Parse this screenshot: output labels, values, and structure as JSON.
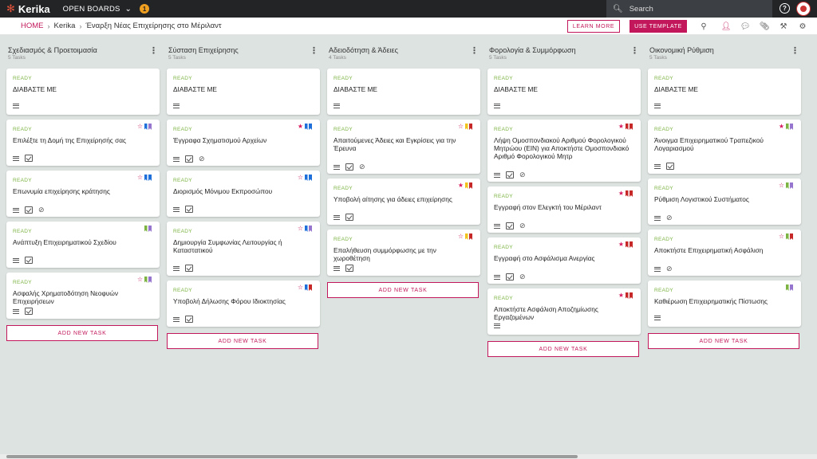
{
  "app": {
    "name": "Kerika",
    "open_boards_label": "OPEN BOARDS",
    "notification_count": "1"
  },
  "search": {
    "placeholder": "Search"
  },
  "breadcrumb": {
    "home": "HOME",
    "org": "Kerika",
    "board": "Έναρξη Νέας Επιχείρησης στο Μέριλαντ"
  },
  "actions": {
    "learn_more": "LEARN MORE",
    "use_template": "USE TEMPLATE"
  },
  "colors": {
    "accent": "#c2185b",
    "ready": "#7cb342",
    "flag_blue": "#1e6fd9",
    "flag_purple": "#9575cd",
    "flag_green": "#7cb342",
    "flag_yellow": "#f2c31c",
    "flag_red": "#c62828"
  },
  "add_task_label": "ADD NEW TASK",
  "status_ready": "READY",
  "columns": [
    {
      "title": "Σχεδιασμός & Προετοιμασία",
      "count": "5 Tasks",
      "cards": [
        {
          "title": "ΔΙΑΒΑΣΤΕ ΜΕ",
          "icons": [
            "lines"
          ],
          "flags": []
        },
        {
          "title": "Επιλέξτε τη Δομή της Επιχείρησής σας",
          "icons": [
            "lines",
            "check"
          ],
          "star": "outline",
          "flags": [
            "blue",
            "purple"
          ]
        },
        {
          "title": "Επωνυμία επιχείρησης κράτησης",
          "icons": [
            "lines",
            "check",
            "clip"
          ],
          "star": "outline",
          "flags": [
            "blue",
            "blue"
          ]
        },
        {
          "title": "Ανάπτυξη Επιχειρηματικού Σχεδίου",
          "icons": [
            "lines",
            "check"
          ],
          "flags": [
            "green",
            "purple"
          ]
        },
        {
          "title": "Ασφαλής Χρηματοδότηση Νεοφυών Επιχειρήσεων",
          "icons": [
            "lines",
            "check"
          ],
          "star": "outline",
          "flags": [
            "green",
            "purple"
          ]
        }
      ]
    },
    {
      "title": "Σύσταση Επιχείρησης",
      "count": "5 Tasks",
      "cards": [
        {
          "title": "ΔΙΑΒΑΣΤΕ ΜΕ",
          "icons": [
            "lines"
          ],
          "flags": []
        },
        {
          "title": "Έγγραφα Σχηματισμού Αρχείων",
          "icons": [
            "lines",
            "check",
            "clip"
          ],
          "star": "filled",
          "flags": [
            "blue",
            "blue"
          ]
        },
        {
          "title": "Διορισμός Μόνιμου Εκπροσώπου",
          "icons": [
            "lines",
            "check"
          ],
          "star": "outline",
          "flags": [
            "blue",
            "blue"
          ]
        },
        {
          "title": "Δημιουργία Συμφωνίας Λειτουργίας ή Καταστατικού",
          "icons": [
            "lines",
            "check"
          ],
          "star": "outline",
          "flags": [
            "blue",
            "purple"
          ]
        },
        {
          "title": "Υποβολή Δήλωσης Φόρου Ιδιοκτησίας",
          "icons": [
            "lines",
            "check"
          ],
          "star": "outline",
          "flags": [
            "blue",
            "red"
          ]
        }
      ]
    },
    {
      "title": "Αδειοδότηση & Άδειες",
      "count": "4 Tasks",
      "cards": [
        {
          "title": "ΔΙΑΒΑΣΤΕ ΜΕ",
          "icons": [
            "lines"
          ],
          "flags": []
        },
        {
          "title": "Απαιτούμενες Άδειες και Εγκρίσεις για την Έρευνα",
          "icons": [
            "lines",
            "check",
            "clip"
          ],
          "star": "outline",
          "flags": [
            "yellow",
            "red"
          ]
        },
        {
          "title": "Υποβολή αίτησης για άδειες επιχείρησης",
          "icons": [
            "lines",
            "check"
          ],
          "star": "filled",
          "flags": [
            "yellow",
            "red"
          ]
        },
        {
          "title": "Επαλήθευση συμμόρφωσης με την χωροθέτηση",
          "icons": [
            "lines",
            "check"
          ],
          "star": "outline",
          "flags": [
            "yellow",
            "red"
          ]
        }
      ]
    },
    {
      "title": "Φορολογία & Συμμόρφωση",
      "count": "5 Tasks",
      "cards": [
        {
          "title": "ΔΙΑΒΑΣΤΕ ΜΕ",
          "icons": [
            "lines"
          ],
          "flags": []
        },
        {
          "title": "Λήψη Ομοσπονδιακού Αριθμού Φορολογικού Μητρώου (EIN) για Αποκτήστε Ομοσπονδιακό Αριθμό Φορολογικού Μητρ",
          "icons": [
            "lines",
            "check",
            "clip"
          ],
          "star": "filled",
          "flags": [
            "red",
            "red"
          ]
        },
        {
          "title": "Εγγραφή στον Ελεγκτή του Μέριλαντ",
          "icons": [
            "lines",
            "check",
            "clip"
          ],
          "star": "filled",
          "flags": [
            "red",
            "red"
          ]
        },
        {
          "title": "Εγγραφή στο Ασφάλισμα Ανεργίας",
          "icons": [
            "lines",
            "check",
            "clip"
          ],
          "star": "filled",
          "flags": [
            "red",
            "red"
          ]
        },
        {
          "title": "Αποκτήστε Ασφάλιση Αποζημίωσης Εργαζομένων",
          "icons": [
            "lines"
          ],
          "star": "filled",
          "flags": [
            "red",
            "red"
          ]
        }
      ]
    },
    {
      "title": "Οικονομική Ρύθμιση",
      "count": "5 Tasks",
      "cards": [
        {
          "title": "ΔΙΑΒΑΣΤΕ ΜΕ",
          "icons": [
            "lines"
          ],
          "flags": []
        },
        {
          "title": "Άνοιγμα Επιχειρηματικού Τραπεζικού Λογαριασμού",
          "icons": [
            "lines",
            "check"
          ],
          "star": "filled",
          "flags": [
            "green",
            "purple"
          ]
        },
        {
          "title": "Ρύθμιση Λογιστικού Συστήματος",
          "icons": [
            "lines",
            "clip"
          ],
          "star": "outline",
          "flags": [
            "green",
            "purple"
          ]
        },
        {
          "title": "Αποκτήστε Επιχειρηματική Ασφάλιση",
          "icons": [
            "lines",
            "clip"
          ],
          "star": "outline",
          "flags": [
            "green",
            "red"
          ]
        },
        {
          "title": "Καθιέρωση Επιχειρηματικής Πίστωσης",
          "icons": [
            "lines"
          ],
          "flags": [
            "green",
            "purple"
          ]
        }
      ]
    }
  ]
}
